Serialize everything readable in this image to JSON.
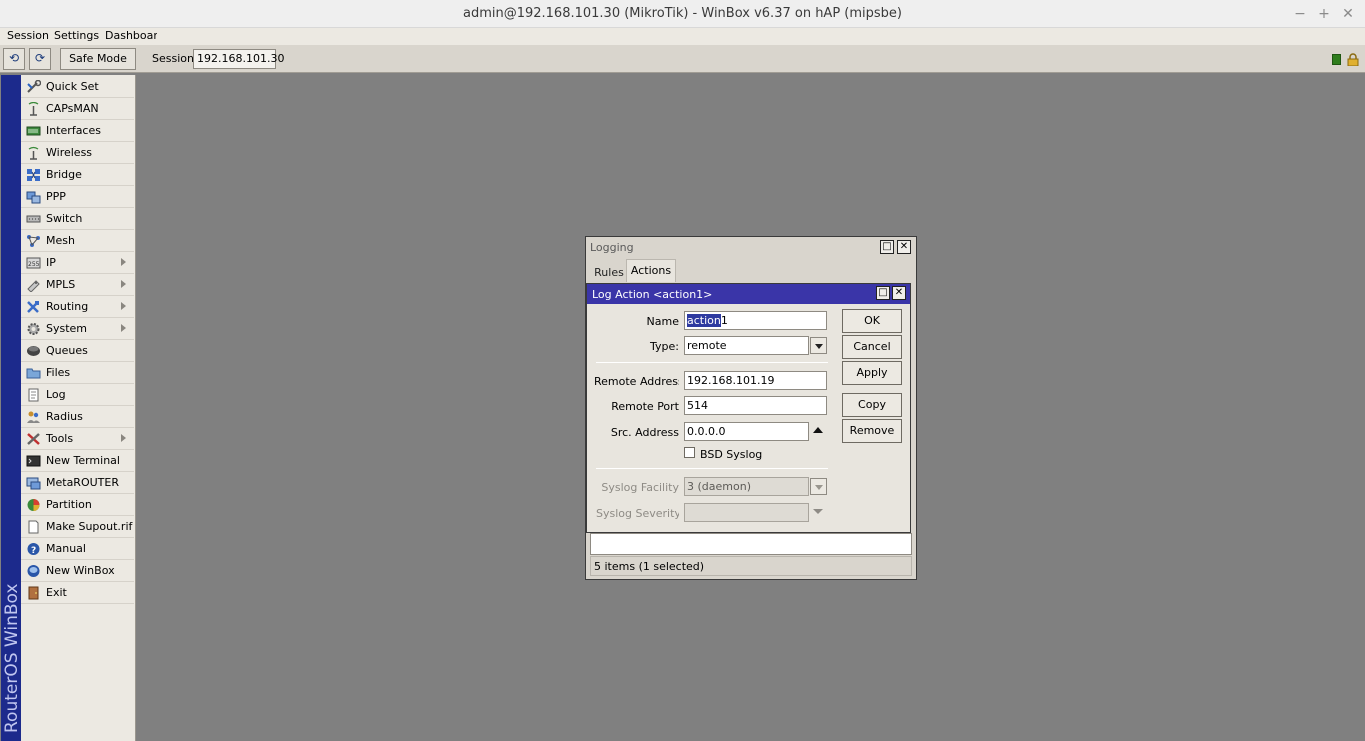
{
  "window": {
    "title": "admin@192.168.101.30 (MikroTik) - WinBox v6.37 on hAP (mipsbe)",
    "controls": [
      "−",
      "+",
      "✕"
    ]
  },
  "menubar": {
    "items": [
      "Session",
      "Settings",
      "Dashboard"
    ]
  },
  "toolbar": {
    "undo": "⟲",
    "redo": "⟳",
    "safe_mode": "Safe Mode",
    "session_label": "Session",
    "session_value": "192.168.101.30"
  },
  "brand": "RouterOS WinBox",
  "sidebar": {
    "items": [
      {
        "label": "Quick Set",
        "icon": "quickset-icon",
        "submenu": false
      },
      {
        "label": "CAPsMAN",
        "icon": "capsman-icon",
        "submenu": false
      },
      {
        "label": "Interfaces",
        "icon": "interfaces-icon",
        "submenu": false
      },
      {
        "label": "Wireless",
        "icon": "wireless-icon",
        "submenu": false
      },
      {
        "label": "Bridge",
        "icon": "bridge-icon",
        "submenu": false
      },
      {
        "label": "PPP",
        "icon": "ppp-icon",
        "submenu": false
      },
      {
        "label": "Switch",
        "icon": "switch-icon",
        "submenu": false
      },
      {
        "label": "Mesh",
        "icon": "mesh-icon",
        "submenu": false
      },
      {
        "label": "IP",
        "icon": "ip-icon",
        "submenu": true
      },
      {
        "label": "MPLS",
        "icon": "mpls-icon",
        "submenu": true
      },
      {
        "label": "Routing",
        "icon": "routing-icon",
        "submenu": true
      },
      {
        "label": "System",
        "icon": "system-icon",
        "submenu": true
      },
      {
        "label": "Queues",
        "icon": "queues-icon",
        "submenu": false
      },
      {
        "label": "Files",
        "icon": "files-icon",
        "submenu": false
      },
      {
        "label": "Log",
        "icon": "log-icon",
        "submenu": false
      },
      {
        "label": "Radius",
        "icon": "radius-icon",
        "submenu": false
      },
      {
        "label": "Tools",
        "icon": "tools-icon",
        "submenu": true
      },
      {
        "label": "New Terminal",
        "icon": "terminal-icon",
        "submenu": false
      },
      {
        "label": "MetaROUTER",
        "icon": "metarouter-icon",
        "submenu": false
      },
      {
        "label": "Partition",
        "icon": "partition-icon",
        "submenu": false
      },
      {
        "label": "Make Supout.rif",
        "icon": "supout-icon",
        "submenu": false
      },
      {
        "label": "Manual",
        "icon": "manual-icon",
        "submenu": false
      },
      {
        "label": "New WinBox",
        "icon": "winbox-icon",
        "submenu": false
      },
      {
        "label": "Exit",
        "icon": "exit-icon",
        "submenu": false
      }
    ]
  },
  "logging_window": {
    "title": "Logging",
    "tabs": [
      "Rules",
      "Actions"
    ],
    "active_tab": "Actions",
    "status": "5 items (1 selected)"
  },
  "log_action_dialog": {
    "title": "Log Action <action1>",
    "name_label": "Name",
    "name_value_selected": "action",
    "name_value_rest": "1",
    "type_label": "Type:",
    "type_value": "remote",
    "remote_address_label": "Remote Address",
    "remote_address_value": "192.168.101.19",
    "remote_port_label": "Remote Port",
    "remote_port_value": "514",
    "src_address_label": "Src. Address",
    "src_address_value": "0.0.0.0",
    "bsd_syslog_label": "BSD Syslog",
    "bsd_syslog_checked": false,
    "syslog_facility_label": "Syslog Facility",
    "syslog_facility_value": "3 (daemon)",
    "syslog_severity_label": "Syslog Severity",
    "syslog_severity_value": "",
    "buttons": {
      "ok": "OK",
      "cancel": "Cancel",
      "apply": "Apply",
      "copy": "Copy",
      "remove": "Remove"
    }
  }
}
